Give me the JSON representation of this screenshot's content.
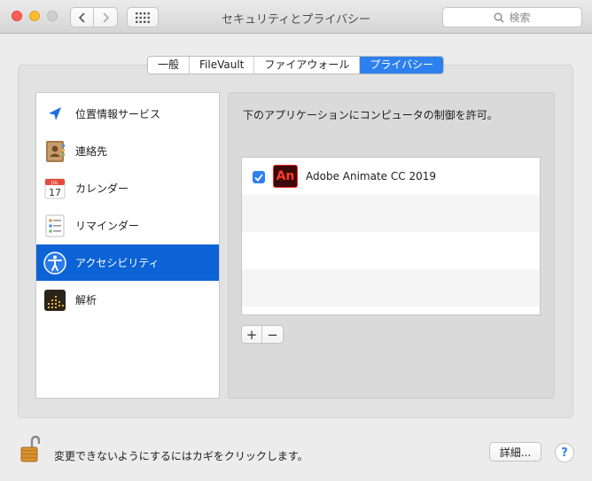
{
  "window": {
    "title": "セキュリティとプライバシー",
    "search_placeholder": "検索"
  },
  "tabs": [
    {
      "label": "一般",
      "active": false
    },
    {
      "label": "FileVault",
      "active": false
    },
    {
      "label": "ファイアウォール",
      "active": false
    },
    {
      "label": "プライバシー",
      "active": true
    }
  ],
  "sidebar": {
    "items": [
      {
        "label": "位置情報サービス",
        "icon": "location-arrow-icon",
        "selected": false
      },
      {
        "label": "連絡先",
        "icon": "contacts-book-icon",
        "selected": false
      },
      {
        "label": "カレンダー",
        "icon": "calendar-icon",
        "selected": false,
        "icon_month": "JUL",
        "icon_day": "17"
      },
      {
        "label": "リマインダー",
        "icon": "reminders-list-icon",
        "selected": false
      },
      {
        "label": "アクセシビリティ",
        "icon": "accessibility-icon",
        "selected": true
      },
      {
        "label": "解析",
        "icon": "analytics-icon",
        "selected": false
      }
    ]
  },
  "panel": {
    "title": "下のアプリケーションにコンピュータの制御を許可。",
    "apps": [
      {
        "name": "Adobe Animate CC 2019",
        "checked": true,
        "icon_text": "An"
      }
    ],
    "add_label": "+",
    "remove_label": "−"
  },
  "footer": {
    "lock_message": "変更できないようにするにはカギをクリックします。",
    "details_label": "詳細...",
    "help_label": "?"
  },
  "colors": {
    "accent": "#2e80ef",
    "selection": "#0b63d6",
    "close": "#fc5f57",
    "minimize": "#fdbc2e"
  }
}
